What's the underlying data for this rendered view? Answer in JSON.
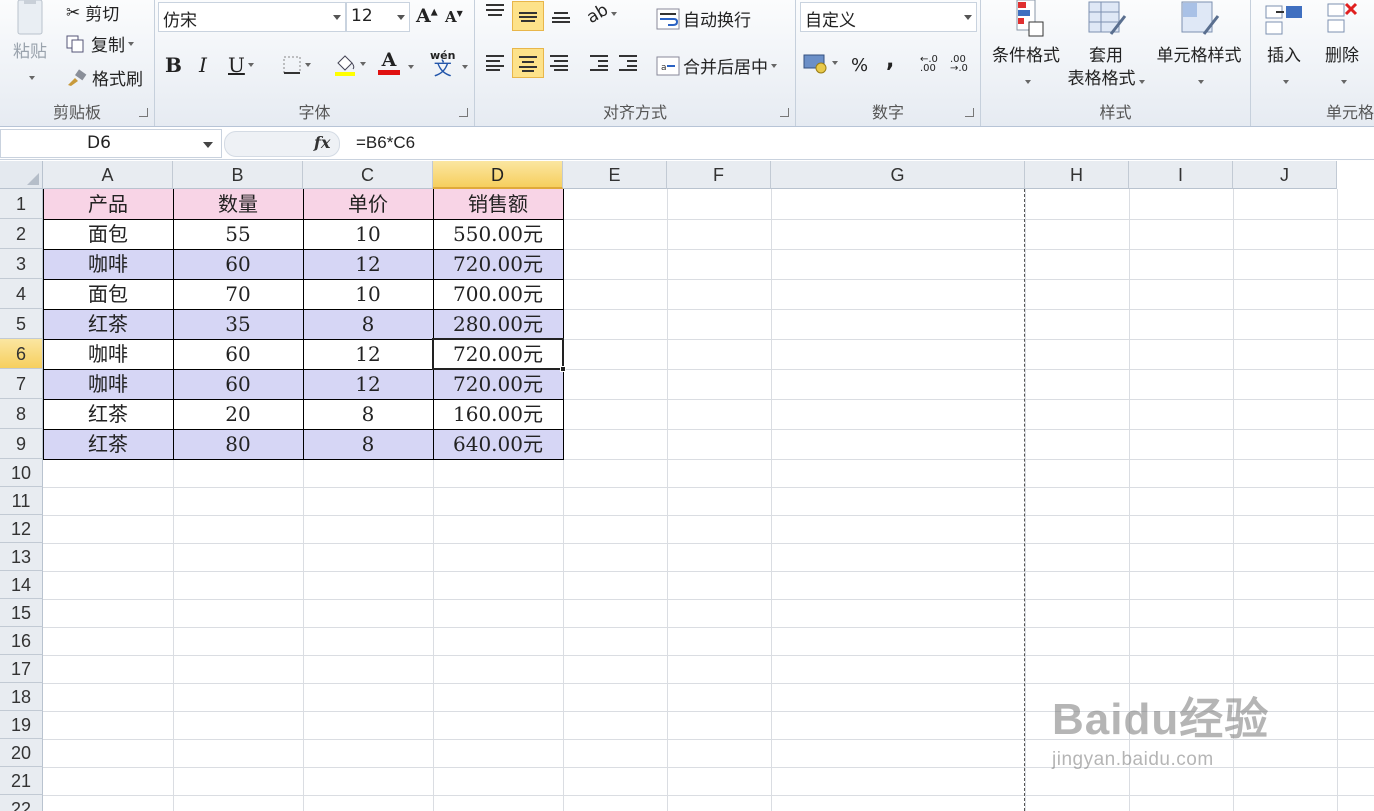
{
  "ribbon": {
    "clipboard": {
      "label": "剪贴板",
      "paste_label": "粘贴",
      "cut_label": "剪切",
      "copy_label": "复制",
      "format_painter_label": "格式刷"
    },
    "font": {
      "label": "字体",
      "font_name": "仿宋",
      "font_size": "12",
      "bold": "B",
      "italic": "I",
      "underline": "U",
      "font_color_glyph": "A",
      "phonetic_top": "wén",
      "phonetic_glyph": "文"
    },
    "alignment": {
      "label": "对齐方式",
      "wrap_text_label": "自动换行",
      "merge_center_label": "合并后居中"
    },
    "number": {
      "label": "数字",
      "format": "自定义",
      "percent": "%",
      "comma": ","
    },
    "styles": {
      "label": "样式",
      "conditional_label": "条件格式",
      "table_format_line1": "套用",
      "table_format_line2": "表格格式",
      "cell_styles_label": "单元格样式"
    },
    "cells": {
      "label": "单元格",
      "insert_label": "插入",
      "delete_label": "删除"
    }
  },
  "formula_bar": {
    "name_box": "D6",
    "fx": "fx",
    "formula": "=B6*C6"
  },
  "sheet": {
    "columns": [
      "A",
      "B",
      "C",
      "D",
      "E",
      "F",
      "G",
      "H",
      "I",
      "J"
    ],
    "selected_column": "D",
    "rows": [
      "1",
      "2",
      "3",
      "4",
      "5",
      "6",
      "7",
      "8",
      "9",
      "10",
      "11",
      "12",
      "13",
      "14",
      "15",
      "16",
      "17",
      "18",
      "19",
      "20",
      "21",
      "22"
    ],
    "selected_row": "6",
    "headers": [
      "产品",
      "数量",
      "单价",
      "销售额"
    ],
    "data": [
      [
        "面包",
        "55",
        "10",
        "550.00元"
      ],
      [
        "咖啡",
        "60",
        "12",
        "720.00元"
      ],
      [
        "面包",
        "70",
        "10",
        "700.00元"
      ],
      [
        "红茶",
        "35",
        "8",
        "280.00元"
      ],
      [
        "咖啡",
        "60",
        "12",
        "720.00元"
      ],
      [
        "咖啡",
        "60",
        "12",
        "720.00元"
      ],
      [
        "红茶",
        "20",
        "8",
        "160.00元"
      ],
      [
        "红茶",
        "80",
        "8",
        "640.00元"
      ]
    ]
  },
  "colors": {
    "header_fill": "#f8d4e6",
    "band_fill": "#d6d6f5",
    "selection_header": "#f6cf5e"
  },
  "watermark": {
    "brand": "Baidu经验",
    "url": "jingyan.baidu.com"
  }
}
